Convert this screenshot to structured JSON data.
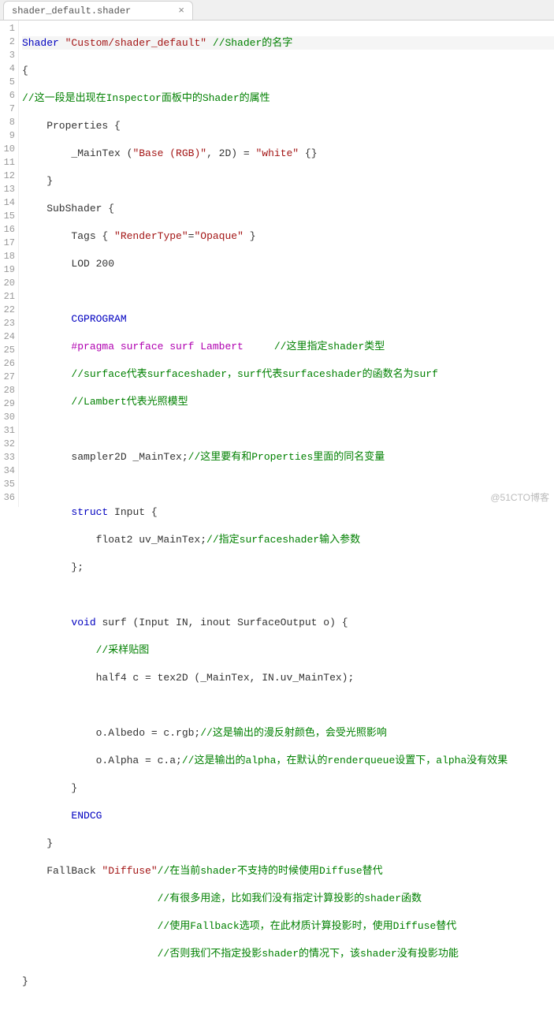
{
  "tab": {
    "filename": "shader_default.shader",
    "close": "×"
  },
  "lines": {
    "l1_kw": "Shader",
    "l1_str": " \"Custom/shader_default\"",
    "l1_c": " //Shader的名字",
    "l2": "{",
    "l3_c": "//这一段是出现在Inspector面板中的Shader的属性",
    "l4a": "    Properties {",
    "l5a": "        _MainTex (",
    "l5b": "\"Base (RGB)\"",
    "l5c": ", 2D) = ",
    "l5d": "\"white\"",
    "l5e": " {}",
    "l6": "    }",
    "l7": "    SubShader {",
    "l8a": "        Tags { ",
    "l8b": "\"RenderType\"",
    "l8c": "=",
    "l8d": "\"Opaque\"",
    "l8e": " }",
    "l9": "        LOD 200",
    "l11": "        CGPROGRAM",
    "l12a": "        ",
    "l12b": "#pragma",
    "l12c": " surface surf Lambert     ",
    "l12d": "//这里指定shader类型",
    "l13": "        //surface代表surfaceshader，surf代表surfaceshader的函数名为surf",
    "l14": "        //Lambert代表光照模型",
    "l16a": "        sampler2D _MainTex;",
    "l16b": "//这里要有和Properties里面的同名变量",
    "l18a": "        ",
    "l18b": "struct",
    "l18c": " Input {",
    "l19a": "            float2 uv_MainTex;",
    "l19b": "//指定surfaceshader输入参数",
    "l20": "        };",
    "l22a": "        ",
    "l22b": "void",
    "l22c": " surf (Input IN, inout SurfaceOutput o) {",
    "l23": "            //采样贴图",
    "l24": "            half4 c = tex2D (_MainTex, IN.uv_MainTex);",
    "l26a": "            o.Albedo = c.rgb;",
    "l26b": "//这是输出的漫反射颜色，会受光照影响",
    "l27a": "            o.Alpha = c.a;",
    "l27b": "//这是输出的alpha，在默认的renderqueue设置下，alpha没有效果",
    "l28": "        }",
    "l29": "        ENDCG",
    "l30": "    }",
    "l31a": "    FallBack ",
    "l31b": "\"Diffuse\"",
    "l31c": "//在当前shader不支持的时候使用Diffuse替代",
    "l32": "                      //有很多用途，比如我们没有指定计算投影的shader函数",
    "l33": "                      //使用Fallback选项，在此材质计算投影时，使用Diffuse替代",
    "l34": "                      //否则我们不指定投影shader的情况下，该shader没有投影功能",
    "l35": "}"
  },
  "watermark": "@51CTO博客"
}
